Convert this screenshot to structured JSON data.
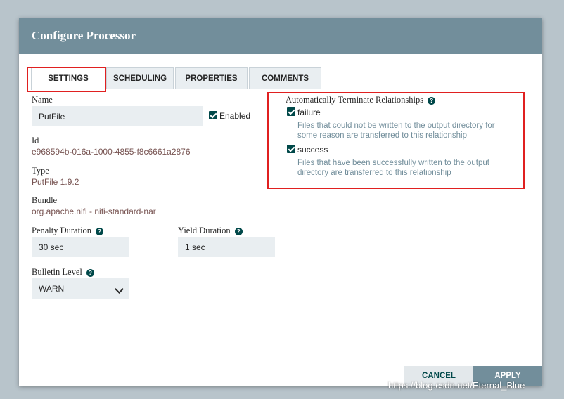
{
  "dialog": {
    "title": "Configure Processor"
  },
  "tabs": [
    {
      "label": "SETTINGS"
    },
    {
      "label": "SCHEDULING"
    },
    {
      "label": "PROPERTIES"
    },
    {
      "label": "COMMENTS"
    }
  ],
  "settings": {
    "name_label": "Name",
    "name_value": "PutFile",
    "enabled_label": "Enabled",
    "id_label": "Id",
    "id_value": "e968594b-016a-1000-4855-f8c6661a2876",
    "type_label": "Type",
    "type_value": "PutFile 1.9.2",
    "bundle_label": "Bundle",
    "bundle_value": "org.apache.nifi - nifi-standard-nar",
    "penalty_label": "Penalty Duration",
    "penalty_value": "30 sec",
    "yield_label": "Yield Duration",
    "yield_value": "1 sec",
    "bulletin_label": "Bulletin Level",
    "bulletin_value": "WARN",
    "help_glyph": "?"
  },
  "relationships": {
    "title": "Automatically Terminate Relationships",
    "items": [
      {
        "name": "failure",
        "description": "Files that could not be written to the output directory for some reason are transferred to this relationship"
      },
      {
        "name": "success",
        "description": "Files that have been successfully written to the output directory are transferred to this relationship"
      }
    ]
  },
  "buttons": {
    "cancel": "CANCEL",
    "apply": "APPLY"
  },
  "watermark": "https://blog.csdn.net/Eternal_Blue",
  "colors": {
    "header": "#728e9b",
    "accent": "#004849",
    "highlight": "#e02020",
    "apply": "#728e9b"
  }
}
